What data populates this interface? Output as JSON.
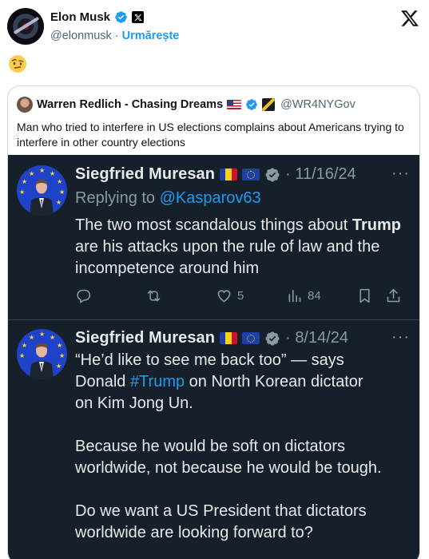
{
  "post": {
    "author_name": "Elon Musk",
    "handle": "@elonmusk",
    "separator": "·",
    "follow_label": "Urmărește",
    "emoji": "🤨"
  },
  "quote": {
    "author_name": "Warren Redlich - Chasing Dreams",
    "handle": "@WR4NYGov",
    "text": "Man who tried to interfere in US elections complains about Americans trying to interfere in other country elections"
  },
  "screenshot": {
    "tweets": [
      {
        "author_name": "Siegfried Muresan",
        "date": "11/16/24",
        "more": "···",
        "replying_prefix": "Replying to ",
        "replying_to": "@Kasparov63",
        "body_before": "The two most scandalous things about ",
        "body_bold": "Trump",
        "body_after": " are his attacks upon the rule of law and the incompetence around him",
        "likes": "5",
        "views": "84"
      },
      {
        "author_name": "Siegfried Muresan",
        "date": "8/14/24",
        "more": "···",
        "line1": "“He’d like to see me back too” — says",
        "line2_before": "Donald ",
        "hashtag": "#Trump",
        "line2_after": " on North Korean dictator",
        "line3": "on Kim Jong Un.",
        "para2": "Because he would be soft on dictators worldwide, not because he would be tough.",
        "para3": "Do we want a US President that dictators worldwide are looking forward to?"
      }
    ]
  },
  "colors": {
    "accent": "#1d9bf0",
    "dark_bg": "#15202b",
    "muted": "#8b98a5"
  },
  "icons": [
    "verified-badge-icon",
    "x-logo-icon",
    "reply-icon",
    "retweet-icon",
    "like-icon",
    "views-icon",
    "bookmark-icon",
    "share-icon",
    "more-icon"
  ]
}
